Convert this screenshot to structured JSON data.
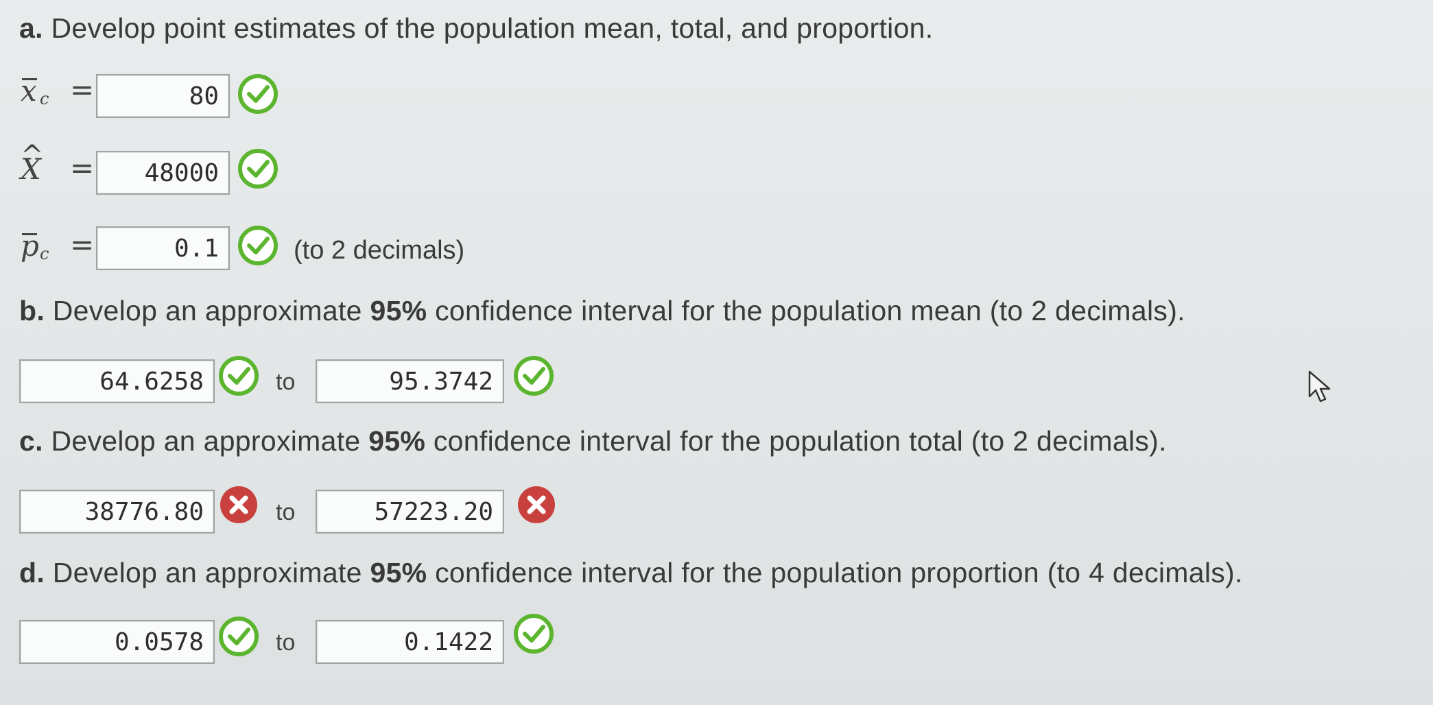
{
  "parts": {
    "a": {
      "letter": "a.",
      "text": " Develop point estimates of the population mean, total, and proportion.",
      "mean": {
        "symbol": "x",
        "sub": "c",
        "eq": "=",
        "value": "80",
        "status": "correct"
      },
      "total": {
        "symbol": "X",
        "hat": "^",
        "eq": "=",
        "value": "48000",
        "status": "correct"
      },
      "proportion": {
        "symbol": "p",
        "sub": "c",
        "eq": "=",
        "value": "0.1",
        "status": "correct",
        "note": "(to 2 decimals)"
      }
    },
    "b": {
      "letter": "b.",
      "text_before": " Develop an approximate ",
      "pct": "95%",
      "text_after": " confidence interval for the population mean (to 2 decimals).",
      "lower": "64.6258",
      "lower_status": "correct",
      "to": "to",
      "upper": "95.3742",
      "upper_status": "correct"
    },
    "c": {
      "letter": "c.",
      "text_before": " Develop an approximate ",
      "pct": "95%",
      "text_after": " confidence interval for the population total (to 2 decimals).",
      "lower": "38776.80",
      "lower_status": "incorrect",
      "to": "to",
      "upper": "57223.20",
      "upper_status": "incorrect"
    },
    "d": {
      "letter": "d.",
      "text_before": " Develop an approximate ",
      "pct": "95%",
      "text_after": " confidence interval for the population proportion (to 4 decimals).",
      "lower": "0.0578",
      "lower_status": "correct",
      "to": "to",
      "upper": "0.1422",
      "upper_status": "correct"
    }
  },
  "icons": {
    "correct": "check-circle-icon",
    "incorrect": "x-circle-icon",
    "cursor": "mouse-pointer-icon"
  },
  "colors": {
    "correct": "#5cb52e",
    "incorrect": "#c9413e",
    "text": "#3a3a3a"
  }
}
